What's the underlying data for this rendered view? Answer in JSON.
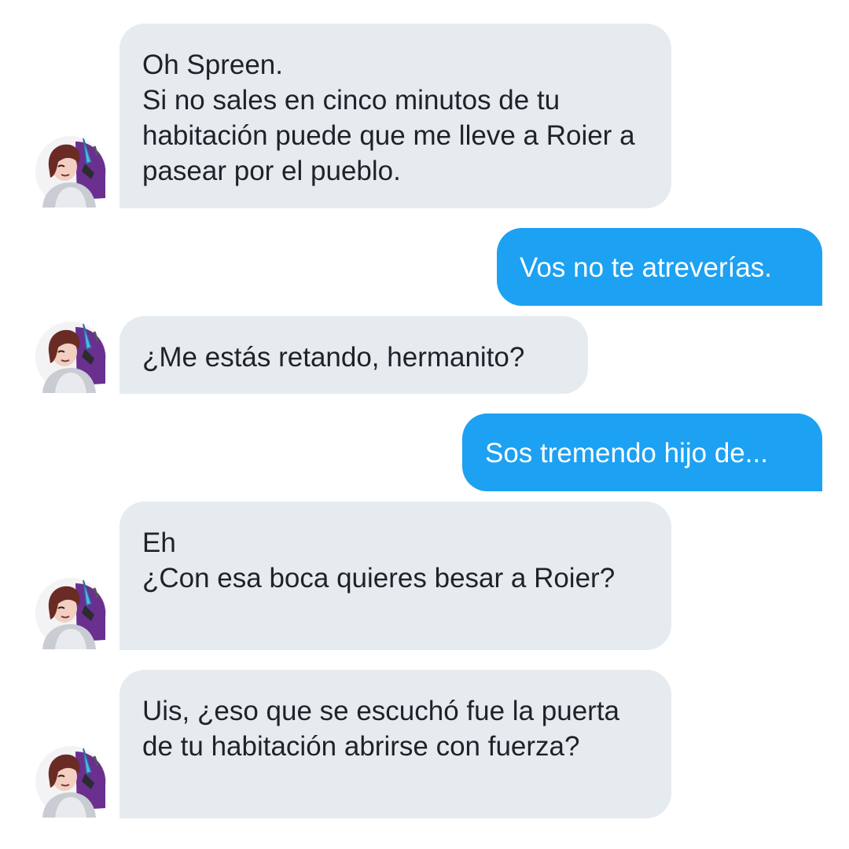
{
  "conversation": {
    "messages": [
      {
        "direction": "incoming",
        "text": "Oh Spreen.\nSi no sales en cinco minutos de tu habitación puede que me lleve a Roier a pasear por el pueblo."
      },
      {
        "direction": "outgoing",
        "text": "Vos no te atreverías."
      },
      {
        "direction": "incoming",
        "text": "¿Me estás retando, hermanito?"
      },
      {
        "direction": "outgoing",
        "text": "Sos tremendo hijo de..."
      },
      {
        "direction": "incoming",
        "text": "Eh\n¿Con esa boca quieres besar a Roier?"
      },
      {
        "direction": "incoming",
        "text": "Uis, ¿eso que se escuchó fue la puerta de tu habitación abrirse con fuerza?"
      }
    ]
  },
  "colors": {
    "incoming_bubble": "#e6ebf0",
    "outgoing_bubble": "#1da1f2",
    "incoming_text": "#1f2328",
    "outgoing_text": "#ffffff",
    "background": "#ffffff"
  }
}
